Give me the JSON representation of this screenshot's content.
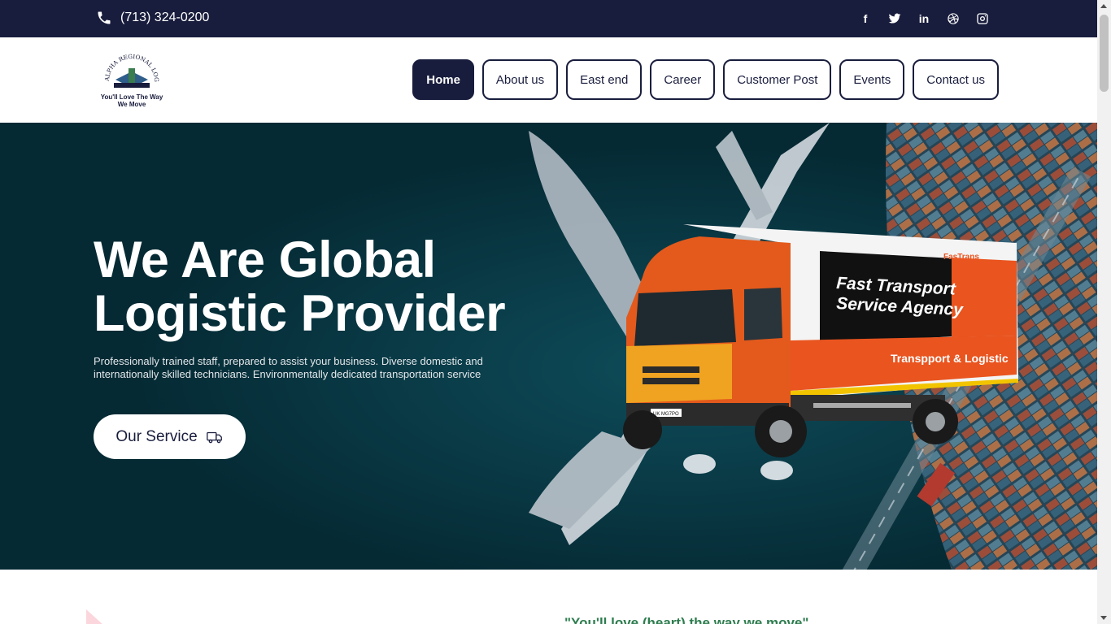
{
  "topbar": {
    "phone": "(713) 324-0200",
    "social": [
      {
        "icon": "facebook-icon",
        "glyph": "f"
      },
      {
        "icon": "twitter-icon",
        "glyph": ""
      },
      {
        "icon": "linkedin-icon",
        "glyph": "in"
      },
      {
        "icon": "dribbble-icon",
        "glyph": ""
      },
      {
        "icon": "instagram-icon",
        "glyph": ""
      }
    ]
  },
  "logo": {
    "ring_text": "ALPHA REGIONAL LOGISTICS LLC",
    "tagline_line1": "You'll Love The Way",
    "tagline_line2": "We Move"
  },
  "nav": {
    "items": [
      {
        "label": "Home",
        "active": true
      },
      {
        "label": "About us"
      },
      {
        "label": "East end"
      },
      {
        "label": "Career"
      },
      {
        "label": "Customer Post"
      },
      {
        "label": "Events"
      },
      {
        "label": "Contact us"
      }
    ]
  },
  "hero": {
    "title_line1": "We Are Global",
    "title_line2": "Logistic Provider",
    "text": "Professionally trained staff, prepared to assist your business. Diverse domestic and internationally skilled technicians. Environmentally dedicated transportation service",
    "button_label": "Our Service",
    "truck_brand": "FasTrans",
    "truck_line1": "Fast Transport",
    "truck_line2": "Service Agency",
    "truck_banner": "Transpport & Logistic",
    "plate": "UK MG7PO"
  },
  "below": {
    "tagline": "\"You'll love (heart) the way we move\""
  },
  "colors": {
    "navy": "#191d3d",
    "hero_bg": "#052a34",
    "truck_orange": "#e9541f",
    "tagline_green": "#2e7d4f"
  }
}
